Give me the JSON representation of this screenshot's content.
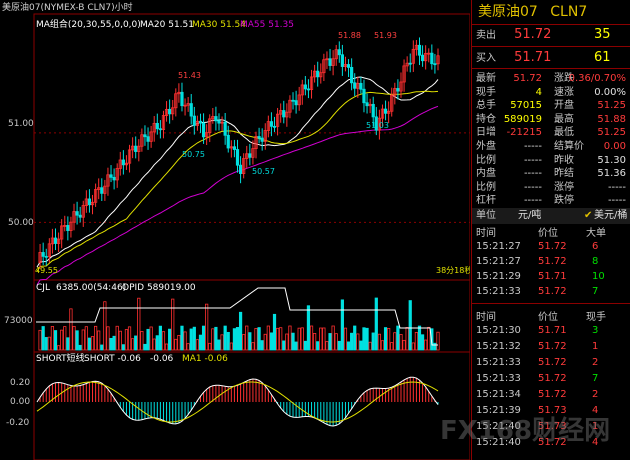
{
  "window": {
    "title": "美原油07(NYMEX-B CLN7)小时"
  },
  "indicators": {
    "ma_group": "MA组合(20,30,55,0,0,0)",
    "ma20": "MA20 51.51",
    "ma30": "MA30 51.54",
    "ma55": "MA55 51.35",
    "vol_label": "CJL",
    "vol_value": "6385.00(54:46)",
    "opid_value": "OPID 589019.00",
    "short_group": "SHORT短线",
    "short1": "SHORT -0.06",
    "short2": "-0.06",
    "ma1": "MA1 -0.06"
  },
  "axis": {
    "y_price": [
      "51.00",
      "50.00"
    ],
    "y_volume": "73000",
    "y_osc": [
      "0.20",
      "0.00",
      "-0.20"
    ],
    "left_tick": "49.55",
    "footer_right": "38分18秒"
  },
  "annotations": [
    "51.88",
    "51.93",
    "51.43",
    "50.75",
    "50.57",
    "51.03"
  ],
  "chart_data": {
    "type": "candlestick",
    "ylim": [
      49.4,
      52.15
    ],
    "series": [
      {
        "name": "MA20",
        "color": "#ffffff"
      },
      {
        "name": "MA30",
        "color": "#e0e000"
      },
      {
        "name": "MA55",
        "color": "#d000d0"
      }
    ]
  },
  "side": {
    "name": "美原油07",
    "code": "CLN7",
    "sell": {
      "label": "卖出",
      "price": "51.72",
      "qty": "35"
    },
    "buy": {
      "label": "买入",
      "price": "51.71",
      "qty": "61"
    },
    "stats_left": [
      {
        "k": "最新",
        "v": "51.72"
      },
      {
        "k": "现手",
        "v": "4"
      },
      {
        "k": "总手",
        "v": "57015"
      },
      {
        "k": "持仓",
        "v": "589019"
      },
      {
        "k": "日增",
        "v": "-21215"
      },
      {
        "k": "外盘",
        "v": "-----"
      },
      {
        "k": "比例",
        "v": "-----"
      },
      {
        "k": "内盘",
        "v": "-----"
      },
      {
        "k": "比例",
        "v": "-----"
      },
      {
        "k": "杠杆",
        "v": "-----"
      }
    ],
    "stats_right": [
      {
        "k": "涨跌",
        "v": "0.36/0.70%"
      },
      {
        "k": "速涨",
        "v": "0.00%"
      },
      {
        "k": "开盘",
        "v": "51.25"
      },
      {
        "k": "最高",
        "v": "51.88"
      },
      {
        "k": "最低",
        "v": "51.25"
      },
      {
        "k": "结算价",
        "v": "0.00"
      },
      {
        "k": "昨收",
        "v": "51.30"
      },
      {
        "k": "昨结",
        "v": "51.36"
      },
      {
        "k": "涨停",
        "v": "-----"
      },
      {
        "k": "跌停",
        "v": "-----"
      }
    ],
    "unit": {
      "label": "单位",
      "v1": "元/吨",
      "v2": "美元/桶"
    },
    "ticks1_head": {
      "t": "时间",
      "p": "价位",
      "q": "大单"
    },
    "ticks1": [
      {
        "t": "15:21:27",
        "p": "51.72",
        "q": "6"
      },
      {
        "t": "15:21:27",
        "p": "51.72",
        "q": "8"
      },
      {
        "t": "15:21:29",
        "p": "51.71",
        "q": "10"
      },
      {
        "t": "15:21:33",
        "p": "51.72",
        "q": "7"
      }
    ],
    "ticks2_head": {
      "t": "时间",
      "p": "价位",
      "q": "现手"
    },
    "ticks2": [
      {
        "t": "15:21:30",
        "p": "51.71",
        "q": "3"
      },
      {
        "t": "15:21:32",
        "p": "51.72",
        "q": "1"
      },
      {
        "t": "15:21:33",
        "p": "51.72",
        "q": "2"
      },
      {
        "t": "15:21:33",
        "p": "51.72",
        "q": "7"
      },
      {
        "t": "15:21:34",
        "p": "51.72",
        "q": "2"
      },
      {
        "t": "15:21:39",
        "p": "51.73",
        "q": "4"
      },
      {
        "t": "15:21:40",
        "p": "51.73",
        "q": "1"
      },
      {
        "t": "15:21:40",
        "p": "51.72",
        "q": "4"
      }
    ]
  },
  "watermark": "FX168财经网"
}
